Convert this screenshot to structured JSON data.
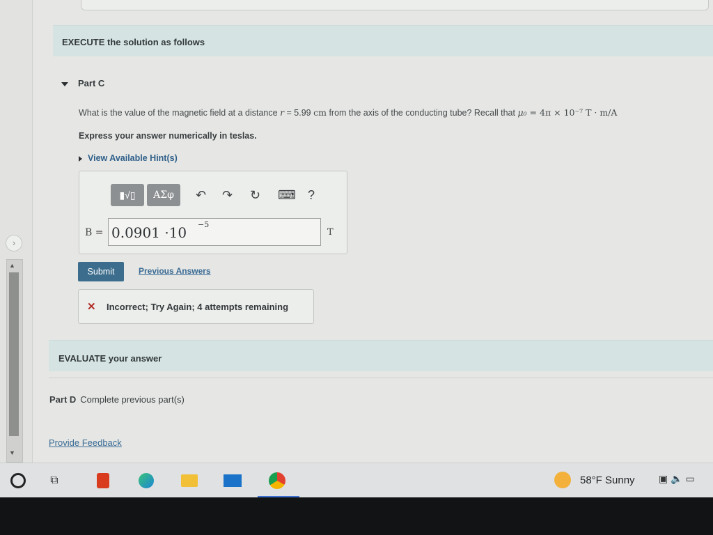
{
  "section_execute": "EXECUTE the solution as follows",
  "part_c": {
    "title": "Part C",
    "question_pre": "What is the value of the magnetic field at a distance ",
    "question_var": "r",
    "question_eq": " = 5.99 ",
    "question_unit": "cm",
    "question_mid": " from the axis of the conducting tube? Recall that ",
    "question_mu": "μ₀",
    "question_mu_val": " = 4π × 10⁻⁷ T · m/A",
    "instruction": "Express your answer numerically in teslas.",
    "hint_link": "View Available Hint(s)"
  },
  "toolbar": {
    "template_button": "▮√▯",
    "greek_button": "ΑΣφ",
    "undo_icon": "↶",
    "redo_icon": "↷",
    "reset_icon": "↻",
    "keyboard_icon": "⌨",
    "help_icon": "?"
  },
  "answer": {
    "variable_label": "B =",
    "value_text": "0.0901 ·10",
    "exponent": "−5",
    "unit": "T"
  },
  "submit_label": "Submit",
  "previous_answers_label": "Previous Answers",
  "feedback": {
    "icon": "✕",
    "message": "Incorrect; Try Again; 4 attempts remaining"
  },
  "section_evaluate": "EVALUATE your answer",
  "part_d": {
    "label": "Part D",
    "status": "Complete previous part(s)"
  },
  "provide_feedback_label": "Provide Feedback",
  "taskbar": {
    "weather": "58°F  Sunny"
  }
}
